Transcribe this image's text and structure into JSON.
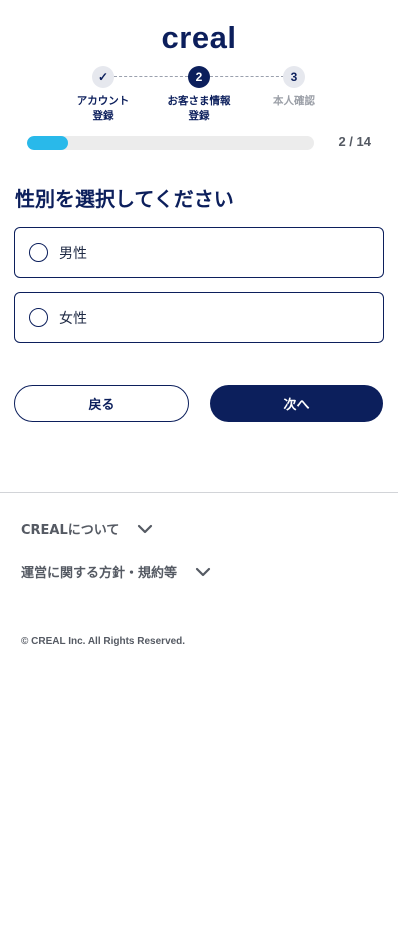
{
  "brand": {
    "logo_text": "creal"
  },
  "stepper": {
    "steps": [
      {
        "status": "done",
        "marker": "✓",
        "label": "アカウント\n登録"
      },
      {
        "status": "current",
        "marker": "2",
        "label": "お客さま情報\n登録"
      },
      {
        "status": "future",
        "marker": "3",
        "label": "本人確認"
      }
    ]
  },
  "progress": {
    "current": 2,
    "total": 14,
    "text": "2 / 14"
  },
  "question": {
    "title": "性別を選択してください"
  },
  "options": [
    {
      "label": "男性",
      "selected": false
    },
    {
      "label": "女性",
      "selected": false
    }
  ],
  "actions": {
    "back_label": "戻る",
    "next_label": "次へ"
  },
  "footer": {
    "links": [
      {
        "label": "CREALについて",
        "icon": "chevron-down-icon"
      },
      {
        "label": "運営に関する方針・規約等",
        "icon": "chevron-down-icon"
      }
    ],
    "copyright": "© CREAL Inc. All Rights Reserved."
  },
  "colors": {
    "primary": "#0c1f5c",
    "progress": "#29b9ea",
    "muted": "#9ca0a8"
  }
}
